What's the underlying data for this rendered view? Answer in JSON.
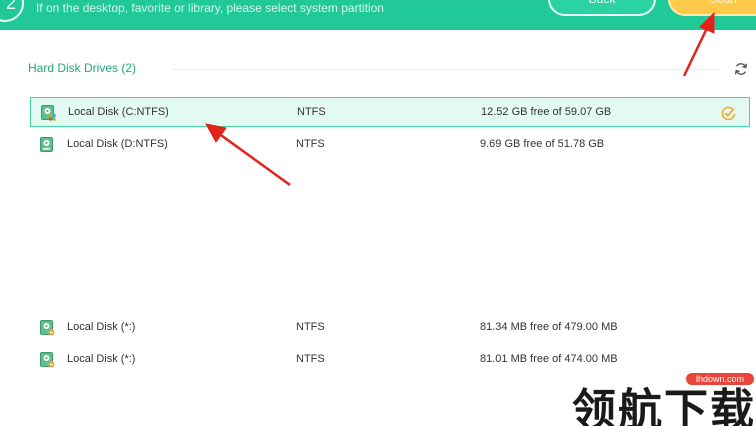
{
  "header": {
    "step_number": "2",
    "hint": "If on the desktop, favorite or library, please select system partition",
    "back_label": "Back",
    "scan_label": "Scan"
  },
  "section": {
    "title": "Hard Disk Drives (2)"
  },
  "drives": [
    {
      "name": "Local Disk (C:NTFS)",
      "fs": "NTFS",
      "space": "12.52 GB free of 59.07 GB",
      "selected": true
    },
    {
      "name": "Local Disk (D:NTFS)",
      "fs": "NTFS",
      "space": "9.69 GB free of 51.78 GB",
      "selected": false
    }
  ],
  "removable": [
    {
      "name": "Local Disk (*:)",
      "fs": "NTFS",
      "space": "81.34 MB free of 479.00 MB"
    },
    {
      "name": "Local Disk (*:)",
      "fs": "NTFS",
      "space": "81.01 MB free of 474.00 MB"
    }
  ],
  "watermark": {
    "badge": "lhdown.com",
    "text": "领航下载"
  },
  "colors": {
    "accent": "#20c997",
    "selected_bg": "#e2faf2",
    "scan_button": "#ffc94a",
    "annotation_arrow": "#e2231a"
  }
}
